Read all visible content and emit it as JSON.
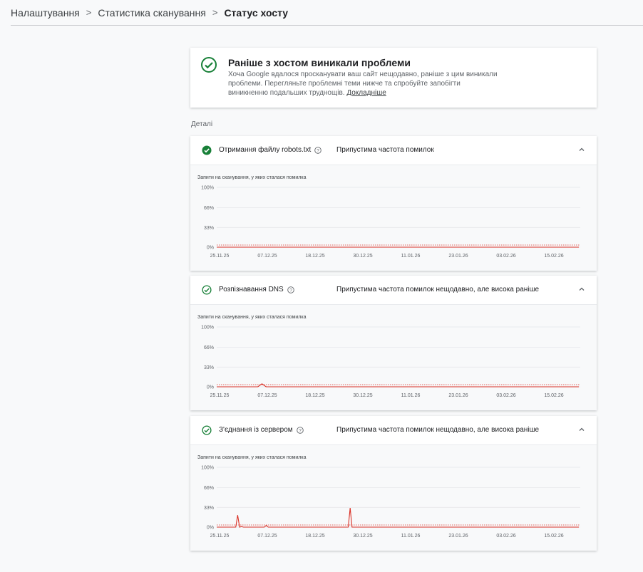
{
  "breadcrumb": {
    "items": [
      "Налаштування",
      "Статистика сканування",
      "Статус хосту"
    ],
    "separator": ">"
  },
  "summary": {
    "icon": "check-circle-icon",
    "title": "Раніше з хостом виникали проблеми",
    "text": "Хоча Google вдалося просканувати ваш сайт нещодавно, раніше з цим виникали проблеми. Перегляньте проблемні теми нижче та спробуйте запобігти виникненню подальших труднощів.",
    "link": "Докладніше"
  },
  "details_label": "Деталі",
  "colors": {
    "ok_green": "#188038",
    "error_red": "#d93025"
  },
  "cards": [
    {
      "title": "Отримання файлу robots.txt",
      "status": "Припустима частота помилок",
      "status_icon": "filled-check-circle-icon",
      "chart_title": "Запити на сканування, у яких сталася помилка",
      "expanded": true
    },
    {
      "title": "Розпізнавання DNS",
      "status": "Припустима частота помилок нещодавно, але висока раніше",
      "status_icon": "outlined-check-circle-icon",
      "chart_title": "Запити на сканування, у яких сталася помилка",
      "expanded": true
    },
    {
      "title": "З'єднання із сервером",
      "status": "Припустима частота помилок нещодавно, але висока раніше",
      "status_icon": "outlined-check-circle-icon",
      "chart_title": "Запити на сканування, у яких сталася помилка",
      "expanded": true
    }
  ],
  "chart_data": [
    {
      "type": "line",
      "series": [
        {
          "values": [
            0,
            0,
            0,
            0,
            0,
            0,
            0,
            0,
            0,
            0,
            0,
            0,
            0,
            0,
            0,
            0,
            0,
            0,
            0,
            0,
            0,
            0,
            0,
            0,
            0,
            0,
            0,
            0,
            0,
            0,
            0,
            0,
            0,
            0,
            0,
            0,
            0,
            0,
            0,
            0,
            0,
            0,
            0,
            0,
            0,
            0,
            0,
            0,
            0,
            0,
            0,
            0,
            0,
            0,
            0,
            0,
            0,
            0,
            0,
            0,
            0,
            0,
            0,
            0,
            0,
            0,
            0,
            0,
            0,
            0,
            0,
            0,
            0,
            0,
            0,
            0,
            0,
            0,
            0,
            0,
            0,
            0,
            0,
            0,
            0,
            0,
            0,
            0,
            0
          ]
        }
      ],
      "x_tick_labels": [
        "25.11.25",
        "07.12.25",
        "18.12.25",
        "30.12.25",
        "11.01.26",
        "23.01.26",
        "03.02.26",
        "15.02.26"
      ],
      "y_tick_labels": [
        "100%",
        "66%",
        "33%",
        "0%"
      ],
      "ylim": [
        0,
        100
      ],
      "threshold_line": 0
    },
    {
      "type": "line",
      "series": [
        {
          "values": [
            0,
            0,
            0,
            0,
            0,
            0,
            0,
            0,
            0,
            0,
            0,
            5,
            0,
            0,
            0,
            0,
            0,
            0,
            0,
            0,
            0,
            0,
            0,
            0,
            0,
            0,
            0,
            0,
            0,
            0,
            0,
            0,
            0,
            0,
            0,
            0,
            0,
            0,
            0,
            0,
            0,
            0,
            0,
            0,
            0,
            0,
            0,
            0,
            0,
            0,
            0,
            0,
            0,
            0,
            0,
            0,
            0,
            0,
            0,
            0,
            0,
            0,
            0,
            0,
            0,
            0,
            0,
            0,
            0,
            0,
            0,
            0,
            0,
            0,
            0,
            0,
            0,
            0,
            0,
            0,
            0,
            0,
            0,
            0,
            0,
            0,
            0,
            0,
            0
          ]
        }
      ],
      "x_tick_labels": [
        "25.11.25",
        "07.12.25",
        "18.12.25",
        "30.12.25",
        "11.01.26",
        "23.01.26",
        "03.02.26",
        "15.02.26"
      ],
      "y_tick_labels": [
        "100%",
        "66%",
        "33%",
        "0%"
      ],
      "ylim": [
        0,
        100
      ],
      "threshold_line": 0
    },
    {
      "type": "line",
      "series": [
        {
          "values": [
            0,
            0,
            0,
            0,
            0,
            0,
            0,
            0,
            0,
            0,
            0,
            20,
            0,
            1,
            0,
            0,
            0,
            0,
            0,
            0,
            0,
            0,
            0,
            0,
            0,
            0,
            3,
            0,
            0,
            0,
            0,
            0,
            0,
            0,
            0,
            0,
            0,
            0,
            0,
            0,
            0,
            0,
            0,
            0,
            0,
            0,
            0,
            0,
            0,
            0,
            0,
            0,
            0,
            0,
            0,
            0,
            0,
            0,
            0,
            0,
            0,
            0,
            0,
            0,
            0,
            0,
            0,
            0,
            0,
            0,
            32,
            0,
            0,
            0,
            0,
            0,
            0,
            0,
            0,
            0,
            0,
            0,
            0,
            0,
            0,
            0,
            0,
            0,
            0,
            0,
            0,
            0,
            0,
            0,
            0,
            0,
            0,
            0,
            0,
            0,
            0,
            0,
            0,
            0,
            0,
            0,
            0,
            0,
            0,
            0,
            0,
            0,
            0,
            0,
            0,
            0,
            0,
            0,
            0,
            0,
            0,
            0,
            0,
            0,
            0,
            0,
            0,
            0,
            0,
            0,
            0,
            0,
            0,
            0,
            0,
            0,
            0,
            0,
            0,
            0,
            0,
            0,
            0,
            0,
            0,
            0,
            0,
            0,
            0,
            0,
            0,
            0,
            0,
            0,
            0,
            0,
            0,
            0,
            0,
            0,
            0,
            0,
            0,
            0,
            0,
            0,
            0,
            0,
            0,
            0,
            0,
            0,
            0,
            0,
            0,
            0,
            0,
            0,
            0,
            0,
            0,
            0,
            0,
            0,
            0,
            0,
            0,
            0,
            0,
            0,
            0
          ]
        }
      ],
      "x_tick_labels": [
        "25.11.25",
        "07.12.25",
        "18.12.25",
        "30.12.25",
        "11.01.26",
        "23.01.26",
        "03.02.26",
        "15.02.26"
      ],
      "y_tick_labels": [
        "100%",
        "66%",
        "33%",
        "0%"
      ],
      "ylim": [
        0,
        100
      ],
      "threshold_line": 0
    }
  ]
}
